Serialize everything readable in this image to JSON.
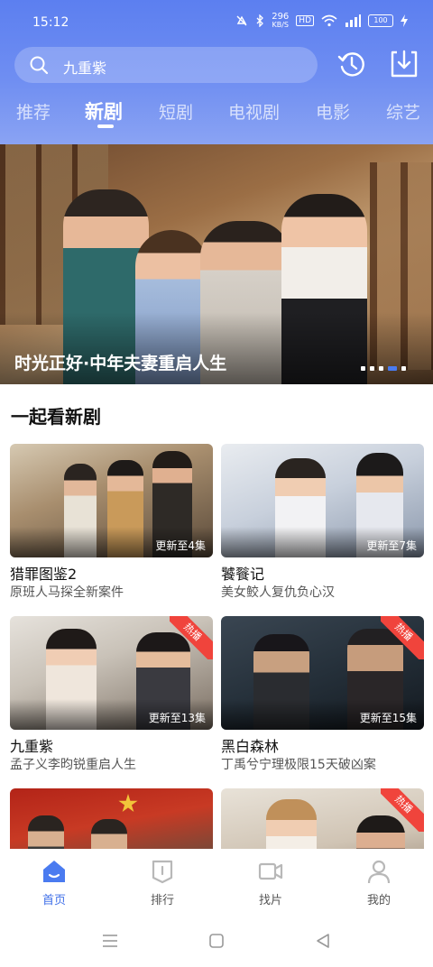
{
  "status_bar": {
    "time": "15:12",
    "net_speed_value": "296",
    "net_speed_unit": "KB/S",
    "hd_label": "HD",
    "battery": "100"
  },
  "search": {
    "query": "九重紫"
  },
  "tabs": [
    {
      "label": "推荐"
    },
    {
      "label": "新剧"
    },
    {
      "label": "短剧"
    },
    {
      "label": "电视剧"
    },
    {
      "label": "电影"
    },
    {
      "label": "综艺"
    }
  ],
  "active_tab": "新剧",
  "banner": {
    "title": "时光正好·中年夫妻重启人生",
    "page_count": 5,
    "active_page": 4
  },
  "section": {
    "title": "一起看新剧"
  },
  "cards": [
    {
      "title": "猎罪图鉴2",
      "desc": "原班人马探全新案件",
      "episodes": "更新至4集",
      "hot": false
    },
    {
      "title": "饕餮记",
      "desc": "美女鲛人复仇负心汉",
      "episodes": "更新至7集",
      "hot": false
    },
    {
      "title": "九重紫",
      "desc": "孟子义李昀锐重启人生",
      "episodes": "更新至13集",
      "hot": true
    },
    {
      "title": "黑白森林",
      "desc": "丁禹兮宁理极限15天破凶案",
      "episodes": "更新至15集",
      "hot": true
    },
    {
      "title": "",
      "desc": "",
      "episodes": "",
      "hot": false
    },
    {
      "title": "",
      "desc": "",
      "episodes": "",
      "hot": true
    }
  ],
  "hot_label": "热播",
  "bottom_nav": [
    {
      "label": "首页",
      "icon": "home-icon"
    },
    {
      "label": "排行",
      "icon": "ranking-icon"
    },
    {
      "label": "找片",
      "icon": "video-camera-icon"
    },
    {
      "label": "我的",
      "icon": "profile-icon"
    }
  ],
  "colors": {
    "accent": "#3f6fe8",
    "header_top": "#5c7ff0",
    "hot_badge": "#f0443c"
  }
}
